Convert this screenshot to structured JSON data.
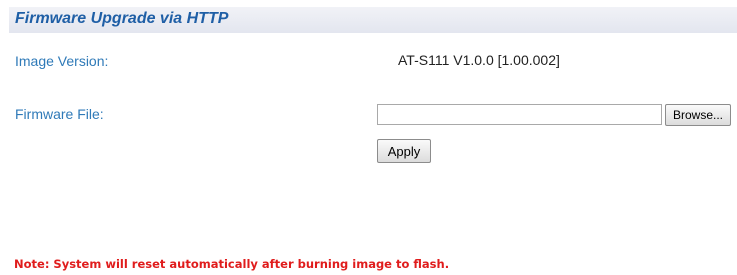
{
  "header": {
    "title": "Firmware Upgrade via HTTP"
  },
  "image_version": {
    "label": "Image Version:",
    "value": "AT-S111 V1.0.0 [1.00.002]"
  },
  "firmware_file": {
    "label": "Firmware File:",
    "value": "",
    "browse_label": "Browse..."
  },
  "actions": {
    "apply_label": "Apply"
  },
  "note": {
    "text": "Note: System will reset automatically after burning image to flash."
  },
  "colors": {
    "title": "#1f5fa6",
    "label": "#2f7ab8",
    "note": "#e01c1c",
    "header_bg": "#e8eaf1"
  }
}
